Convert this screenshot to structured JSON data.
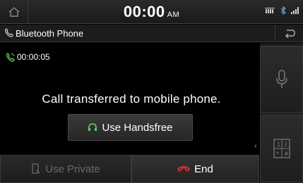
{
  "status": {
    "time": "00:00",
    "ampm": "AM"
  },
  "titlebar": {
    "title": "Bluetooth Phone"
  },
  "call": {
    "duration": "00:00:05",
    "message": "Call transferred to mobile phone.",
    "handsfree_label": "Use Handsfree",
    "private_label": "Use Private",
    "end_label": "End"
  },
  "colors": {
    "accent_green": "#5fd35f",
    "end_red": "#e03030",
    "disabled_gray": "#6a6a6a"
  },
  "icons": {
    "home": "home-icon",
    "bluetooth": "bluetooth-icon",
    "signal": "signal-icon",
    "back": "back-icon",
    "mic": "mic-icon",
    "keypad": "keypad-icon",
    "headset": "headset-icon",
    "phone_device": "phone-device-icon",
    "end_call": "end-call-icon"
  }
}
